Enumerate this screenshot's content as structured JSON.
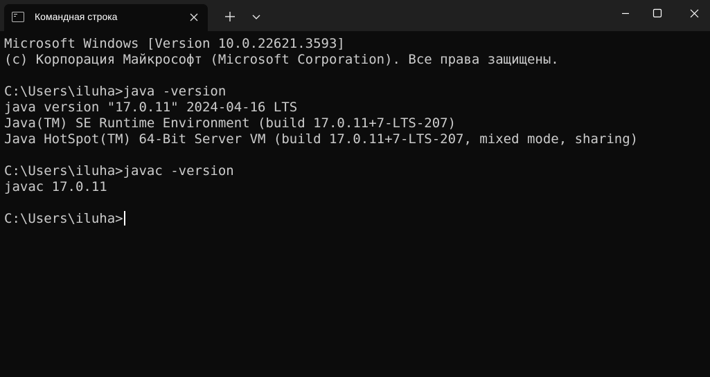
{
  "window": {
    "tab_title": "Командная строка",
    "icons": {
      "app": "terminal-icon",
      "tab_close": "close-icon",
      "new_tab": "plus-icon",
      "dropdown": "chevron-down-icon",
      "minimize": "minimize-icon",
      "maximize": "maximize-icon",
      "close": "close-icon"
    },
    "colors": {
      "titlebar_bg": "#202020",
      "console_bg": "#0c0c0c",
      "console_text": "#cccccc"
    }
  },
  "console": {
    "header_line1": "Microsoft Windows [Version 10.0.22621.3593]",
    "header_line2": "(c) Корпорация Майкрософт (Microsoft Corporation). Все права защищены.",
    "cmd1": "C:\\Users\\iluha>java -version",
    "out1_line1": "java version \"17.0.11\" 2024-04-16 LTS",
    "out1_line2": "Java(TM) SE Runtime Environment (build 17.0.11+7-LTS-207)",
    "out1_line3": "Java HotSpot(TM) 64-Bit Server VM (build 17.0.11+7-LTS-207, mixed mode, sharing)",
    "cmd2": "C:\\Users\\iluha>javac -version",
    "out2_line1": "javac 17.0.11",
    "prompt": "C:\\Users\\iluha>"
  }
}
